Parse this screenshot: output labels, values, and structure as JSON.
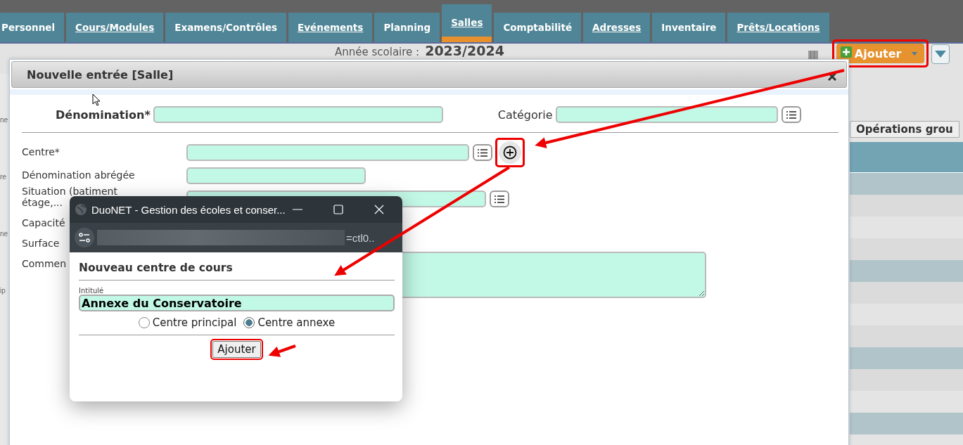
{
  "tabs": [
    {
      "label": "Personnel",
      "link": false,
      "selected": false
    },
    {
      "label": "Cours/Modules",
      "link": true,
      "selected": false
    },
    {
      "label": "Examens/Contrôles",
      "link": false,
      "selected": false
    },
    {
      "label": "Evénements",
      "link": true,
      "selected": false
    },
    {
      "label": "Planning",
      "link": false,
      "selected": false
    },
    {
      "label": "Salles",
      "link": true,
      "selected": true
    },
    {
      "label": "Comptabilité",
      "link": false,
      "selected": false
    },
    {
      "label": "Adresses",
      "link": true,
      "selected": false
    },
    {
      "label": "Inventaire",
      "link": false,
      "selected": false
    },
    {
      "label": "Prêts/Locations",
      "link": true,
      "selected": false
    }
  ],
  "school_year": {
    "label": "Année scolaire :",
    "value": "2023/2024"
  },
  "add_button": "Ajouter",
  "group_operations": "Opérations grou",
  "left_fragments": [
    "ne",
    "re",
    "ne",
    "ip"
  ],
  "table_rows": [
    {
      "highlighted": true
    },
    {
      "highlighted": false
    },
    {
      "highlighted": false
    },
    {
      "highlighted": false
    },
    {
      "highlighted": true
    },
    {
      "highlighted": false
    },
    {
      "highlighted": false
    },
    {
      "highlighted": false
    },
    {
      "highlighted": true
    },
    {
      "highlighted": false
    },
    {
      "highlighted": false
    },
    {
      "highlighted": true
    },
    {
      "highlighted": false
    }
  ],
  "dialog": {
    "title": "Nouvelle entrée [Salle]",
    "top_fields": [
      {
        "label": "Dénomination*",
        "bold": true,
        "list": false
      },
      {
        "label": "Catégorie",
        "bold": false,
        "list": true
      }
    ],
    "fields": [
      {
        "label": "Centre*",
        "kind": "long",
        "list": true,
        "add": true
      },
      {
        "label": "Dénomination abrégée",
        "kind": "short",
        "list": false,
        "add": false
      },
      {
        "label": "Situation (batiment étage,...",
        "kind": "long",
        "list": true,
        "add": false
      },
      {
        "label": "Capacité",
        "kind": "none",
        "list": false,
        "add": false
      },
      {
        "label": "Surface",
        "kind": "none",
        "list": false,
        "add": false
      },
      {
        "label": "Commen",
        "kind": "textarea",
        "list": false,
        "add": false
      }
    ]
  },
  "popup": {
    "title": "DuoNET - Gestion des écoles et conser...",
    "url_tail": "=ctl0..",
    "heading": "Nouveau centre de cours",
    "field_label": "Intitulé",
    "field_value": "Annexe du Conservatoire",
    "options": [
      {
        "label": "Centre principal",
        "selected": false
      },
      {
        "label": "Centre annexe",
        "selected": true
      }
    ],
    "button": "Ajouter"
  }
}
